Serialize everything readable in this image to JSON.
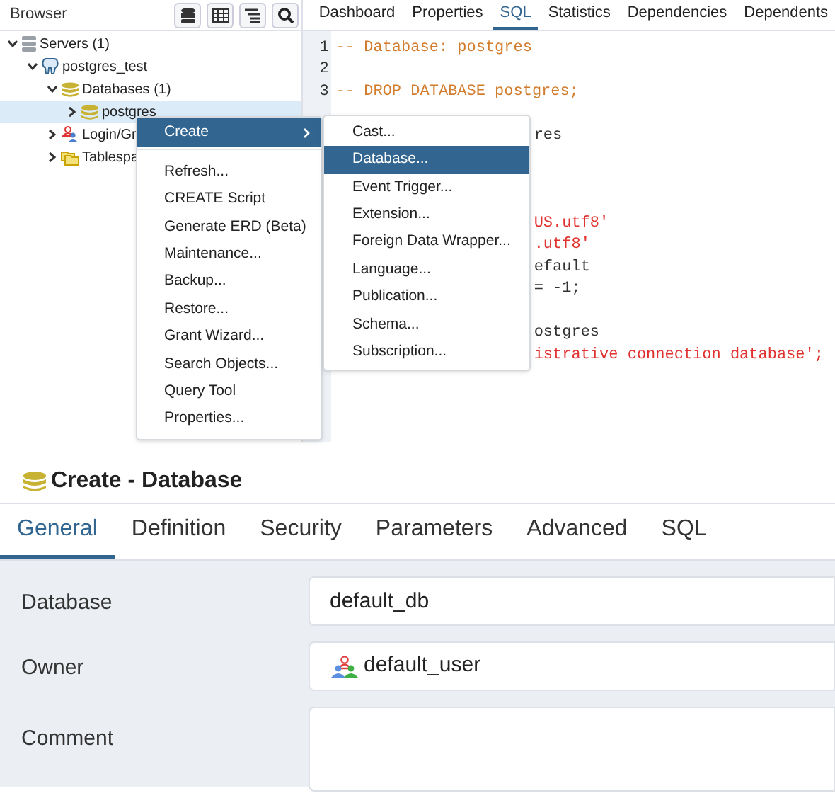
{
  "browser": {
    "title": "Browser",
    "tree": [
      {
        "label": "Servers (1)",
        "kind": "servers",
        "expanded": true,
        "selected": false,
        "children": [
          {
            "label": "postgres_test",
            "kind": "server",
            "expanded": true,
            "selected": false,
            "children": [
              {
                "label": "Databases (1)",
                "kind": "databases",
                "expanded": true,
                "selected": false,
                "children": [
                  {
                    "label": "postgres",
                    "kind": "database",
                    "expanded": false,
                    "selected": true
                  }
                ]
              },
              {
                "label": "Login/Gr",
                "kind": "roles",
                "expanded": false,
                "selected": false
              },
              {
                "label": "Tablespa",
                "kind": "tablespaces",
                "expanded": false,
                "selected": false
              }
            ]
          }
        ]
      }
    ]
  },
  "tabs": [
    {
      "label": "Dashboard",
      "selected": false
    },
    {
      "label": "Properties",
      "selected": false
    },
    {
      "label": "SQL",
      "selected": true
    },
    {
      "label": "Statistics",
      "selected": false
    },
    {
      "label": "Dependencies",
      "selected": false
    },
    {
      "label": "Dependents",
      "selected": false
    }
  ],
  "sql_editor": {
    "lines": [
      {
        "number": "1",
        "text": "-- Database: postgres",
        "kind": "comment"
      },
      {
        "number": "2"
      },
      {
        "number": "3",
        "text": "-- DROP DATABASE postgres;",
        "kind": "comment"
      }
    ],
    "fragments": [
      {
        "text": "res",
        "kind": "plain"
      },
      {
        "text": "US.utf8'",
        "kind": "string"
      },
      {
        "text": ".utf8'",
        "kind": "string"
      },
      {
        "text": "efault",
        "kind": "plain"
      },
      {
        "text": "= -1;",
        "kind": "plain"
      },
      {
        "text": "ostgres",
        "kind": "plain"
      },
      {
        "text": "istrative connection database';",
        "kind": "string"
      }
    ]
  },
  "context_menu": {
    "items": [
      {
        "label": "Create",
        "selected": true,
        "has_submenu": true
      },
      {
        "label": "Refresh...",
        "selected": false,
        "has_submenu": false
      },
      {
        "label": "CREATE Script",
        "selected": false,
        "has_submenu": false
      },
      {
        "label": "Generate ERD (Beta)",
        "selected": false,
        "has_submenu": false
      },
      {
        "label": "Maintenance...",
        "selected": false,
        "has_submenu": false
      },
      {
        "label": "Backup...",
        "selected": false,
        "has_submenu": false
      },
      {
        "label": "Restore...",
        "selected": false,
        "has_submenu": false
      },
      {
        "label": "Grant Wizard...",
        "selected": false,
        "has_submenu": false
      },
      {
        "label": "Search Objects...",
        "selected": false,
        "has_submenu": false
      },
      {
        "label": "Query Tool",
        "selected": false,
        "has_submenu": false
      },
      {
        "label": "Properties...",
        "selected": false,
        "has_submenu": false
      }
    ]
  },
  "submenu": {
    "items": [
      {
        "label": "Cast...",
        "selected": false
      },
      {
        "label": "Database...",
        "selected": true
      },
      {
        "label": "Event Trigger...",
        "selected": false
      },
      {
        "label": "Extension...",
        "selected": false
      },
      {
        "label": "Foreign Data Wrapper...",
        "selected": false
      },
      {
        "label": "Language...",
        "selected": false
      },
      {
        "label": "Publication...",
        "selected": false
      },
      {
        "label": "Schema...",
        "selected": false
      },
      {
        "label": "Subscription...",
        "selected": false
      }
    ]
  },
  "dialog": {
    "title": "Create - Database",
    "tabs": [
      {
        "label": "General",
        "selected": true
      },
      {
        "label": "Definition",
        "selected": false
      },
      {
        "label": "Security",
        "selected": false
      },
      {
        "label": "Parameters",
        "selected": false
      },
      {
        "label": "Advanced",
        "selected": false
      },
      {
        "label": "SQL",
        "selected": false
      }
    ],
    "fields": [
      {
        "label": "Database",
        "kind": "text",
        "value": "default_db"
      },
      {
        "label": "Owner",
        "kind": "owner",
        "value": "default_user"
      },
      {
        "label": "Comment",
        "kind": "textarea"
      }
    ]
  }
}
